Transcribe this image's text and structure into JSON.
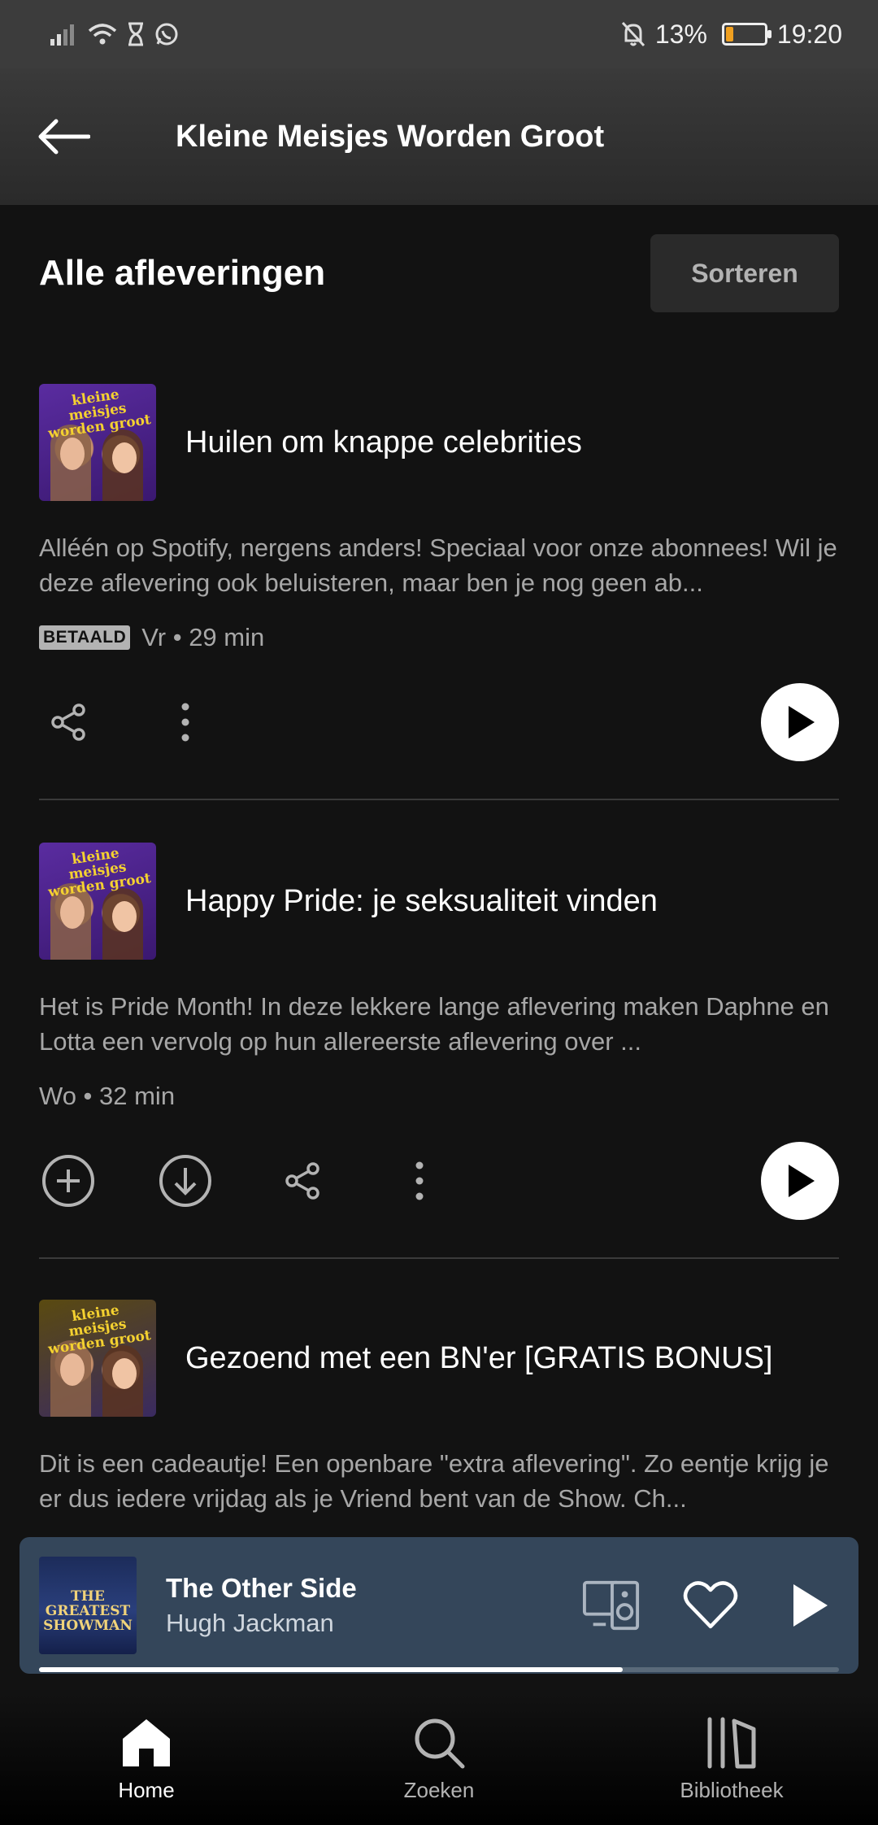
{
  "status_bar": {
    "battery": "13%",
    "time": "19:20",
    "battery_level": 0.13
  },
  "header": {
    "title": "Kleine Meisjes Worden Groot"
  },
  "section": {
    "title": "Alle afleveringen",
    "sort_label": "Sorteren"
  },
  "episodes": [
    {
      "title": "Huilen om knappe celebrities",
      "description": "Alléén op Spotify, nergens anders! Speciaal voor onze abonnees! Wil je deze aflevering ook beluisteren, maar ben je nog geen ab...",
      "badge": "BETAALD",
      "meta": "Vr • 29 min",
      "cover_text": "kleine meisjes worden groot"
    },
    {
      "title": "Happy Pride: je seksualiteit vinden",
      "description": "Het is Pride Month! In deze lekkere lange aflevering maken Daphne en Lotta een vervolg op hun allereerste aflevering over ...",
      "meta": "Wo • 32 min",
      "cover_text": "kleine meisjes worden groot"
    },
    {
      "title": "Gezoend met een BN'er [GRATIS BONUS]",
      "description": "Dit is een cadeautje! Een openbare \"extra aflevering\". Zo eentje krijg je er dus iedere vrijdag als je Vriend bent van de Show. Ch...",
      "cover_text": "kleine meisjes worden groot"
    }
  ],
  "player": {
    "title": "The Other Side",
    "artist": "Hugh Jackman",
    "cover_text": "THE GREATEST SHOWMAN",
    "progress": 0.73
  },
  "nav": [
    {
      "label": "Home",
      "icon": "home-icon",
      "active": true
    },
    {
      "label": "Zoeken",
      "icon": "search-icon",
      "active": false
    },
    {
      "label": "Bibliotheek",
      "icon": "library-icon",
      "active": false
    }
  ],
  "colors": {
    "background": "#121212",
    "player": "#34465a",
    "muted_text": "#a7a7a7"
  }
}
